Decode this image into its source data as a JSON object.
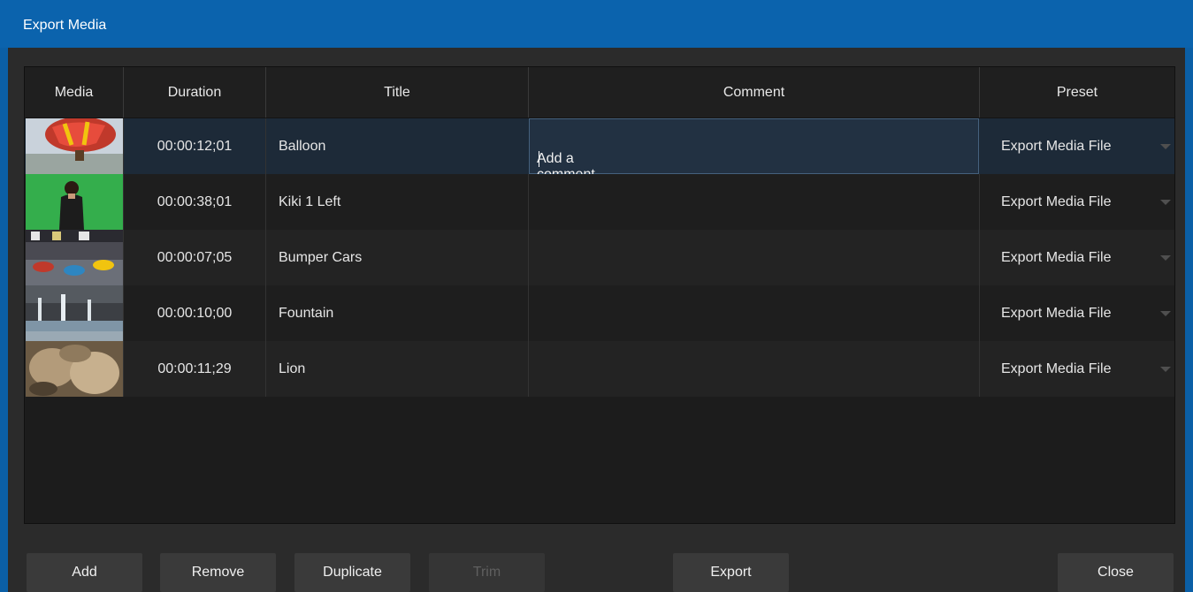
{
  "window": {
    "title": "Export Media"
  },
  "table": {
    "headers": {
      "media": "Media",
      "duration": "Duration",
      "title": "Title",
      "comment": "Comment",
      "preset": "Preset"
    },
    "rows": [
      {
        "duration": "00:00:12;01",
        "title": "Balloon",
        "comment": "Add a comment here ...",
        "preset": "Export Media File",
        "thumb": "balloon"
      },
      {
        "duration": "00:00:38;01",
        "title": "Kiki 1 Left",
        "comment": "",
        "preset": "Export Media File",
        "thumb": "kiki"
      },
      {
        "duration": "00:00:07;05",
        "title": "Bumper Cars",
        "comment": "",
        "preset": "Export Media File",
        "thumb": "bumper-cars"
      },
      {
        "duration": "00:00:10;00",
        "title": "Fountain",
        "comment": "",
        "preset": "Export Media File",
        "thumb": "fountain"
      },
      {
        "duration": "00:00:11;29",
        "title": "Lion",
        "comment": "",
        "preset": "Export Media File",
        "thumb": "lion"
      }
    ]
  },
  "buttons": {
    "add": "Add",
    "remove": "Remove",
    "duplicate": "Duplicate",
    "trim": "Trim",
    "export": "Export",
    "close": "Close"
  },
  "colors": {
    "titlebar": "#0b63ad",
    "selected_row": "#1d2a38",
    "button": "#3a3a3a"
  }
}
